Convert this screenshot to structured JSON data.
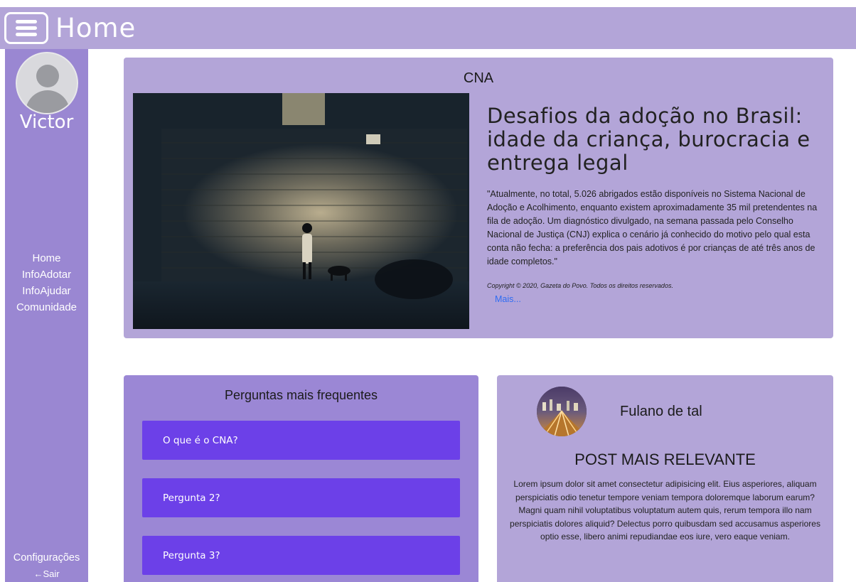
{
  "header": {
    "title": "Home"
  },
  "sidebar": {
    "username": "Victor",
    "nav": [
      {
        "label": "Home"
      },
      {
        "label": "InfoAdotar"
      },
      {
        "label": "InfoAjudar"
      },
      {
        "label": "Comunidade"
      }
    ],
    "settings_label": "Configurações",
    "logout_label": "←Sair"
  },
  "news": {
    "header": "CNA",
    "title": "Desafios da adoção no Brasil: idade da criança, burocracia e entrega legal",
    "text": "\"Atualmente, no total, 5.026 abrigados estão disponíveis no Sistema Nacional de Adoção e Acolhimento, enquanto existem aproximadamente 35 mil pretendentes na fila de adoção. Um diagnóstico divulgado, na semana passada pelo Conselho Nacional de Justiça (CNJ) explica o cenário já conhecido do motivo pelo qual esta conta não fecha: a preferência dos pais adotivos é por crianças de até três anos de idade completos.\"",
    "copyright": "Copyright © 2020, Gazeta do Povo. Todos os direitos reservados.",
    "more_label": "Mais..."
  },
  "faq": {
    "title": "Perguntas mais frequentes",
    "items": [
      {
        "label": "O que é o CNA?"
      },
      {
        "label": "Pergunta 2?"
      },
      {
        "label": "Pergunta 3?"
      }
    ]
  },
  "post": {
    "author": "Fulano de tal",
    "heading": "POST MAIS RELEVANTE",
    "body": "Lorem ipsum dolor sit amet consectetur adipisicing elit. Eius asperiores, aliquam perspiciatis odio tenetur tempore veniam tempora doloremque laborum earum? Magni quam nihil voluptatibus voluptatum autem quis, rerum tempora illo nam perspiciatis dolores aliquid? Delectus porro quibusdam sed accusamus asperiores optio esse, libero animi repudiandae eos iure, vero eaque veniam."
  },
  "colors": {
    "header_bg": "#b3a5d8",
    "sidebar_bg": "#9a87d2",
    "card_bg": "#b3a5d8",
    "faq_card_bg": "#9b87d5",
    "faq_item_bg": "#6c40e8",
    "link": "#2f6cf3"
  },
  "icons": {
    "menu": "hamburger-menu-icon",
    "avatar": "user-avatar-icon"
  }
}
